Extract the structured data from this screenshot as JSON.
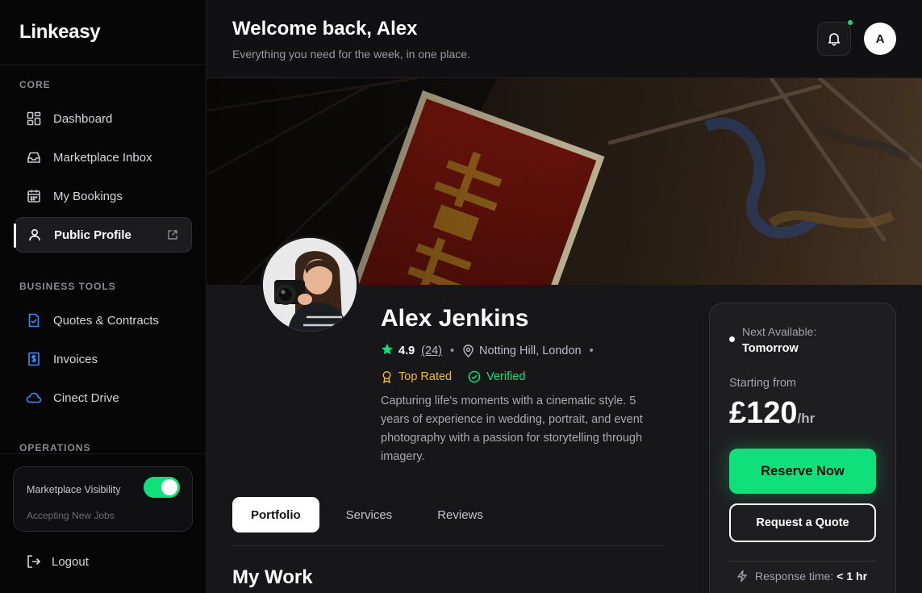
{
  "brand": "Linkeasy",
  "sidebar": {
    "sections": [
      "CORE",
      "BUSINESS TOOLS",
      "OPERATIONS"
    ],
    "core_items": [
      {
        "label": "Dashboard",
        "icon": "grid-icon"
      },
      {
        "label": "Marketplace Inbox",
        "icon": "inbox-icon"
      },
      {
        "label": "My Bookings",
        "icon": "calendar-icon"
      },
      {
        "label": "Public Profile",
        "icon": "user-icon",
        "active": true
      }
    ],
    "business_items": [
      {
        "label": "Quotes & Contracts",
        "icon": "document-check-icon"
      },
      {
        "label": "Invoices",
        "icon": "dollar-document-icon"
      },
      {
        "label": "Cinect Drive",
        "icon": "cloud-icon"
      }
    ],
    "visibility": {
      "title": "Marketplace Visibility",
      "subtitle": "Accepting New Jobs",
      "enabled": true
    },
    "logout": "Logout"
  },
  "header": {
    "title": "Welcome back, Alex",
    "subtitle": "Everything you need for the week, in one place.",
    "avatar_initial": "A",
    "has_notification": true
  },
  "profile": {
    "name": "Alex Jenkins",
    "rating": "4.9",
    "review_count": "(24)",
    "location": "Notting Hill, London",
    "badge_top_rated": "Top Rated",
    "badge_verified": "Verified",
    "bio": "Capturing life's moments with a cinematic style. 5 years of experience in wedding, portrait, and event photography with a passion for storytelling through imagery."
  },
  "tabs": [
    "Portfolio",
    "Services",
    "Reviews"
  ],
  "active_tab": "Portfolio",
  "section_title": "My Work",
  "booking": {
    "availability_label": "Next Available:",
    "availability_value": "Tomorrow",
    "starting_label": "Starting from",
    "price": "£120",
    "price_unit": "/hr",
    "reserve_label": "Reserve Now",
    "quote_label": "Request a Quote",
    "response_label": "Response time:",
    "response_value": "< 1 hr"
  },
  "colors": {
    "accent": "#10e07a",
    "top_rated": "#f5b83d",
    "background": "#17171a",
    "sidebar": "#060606"
  }
}
